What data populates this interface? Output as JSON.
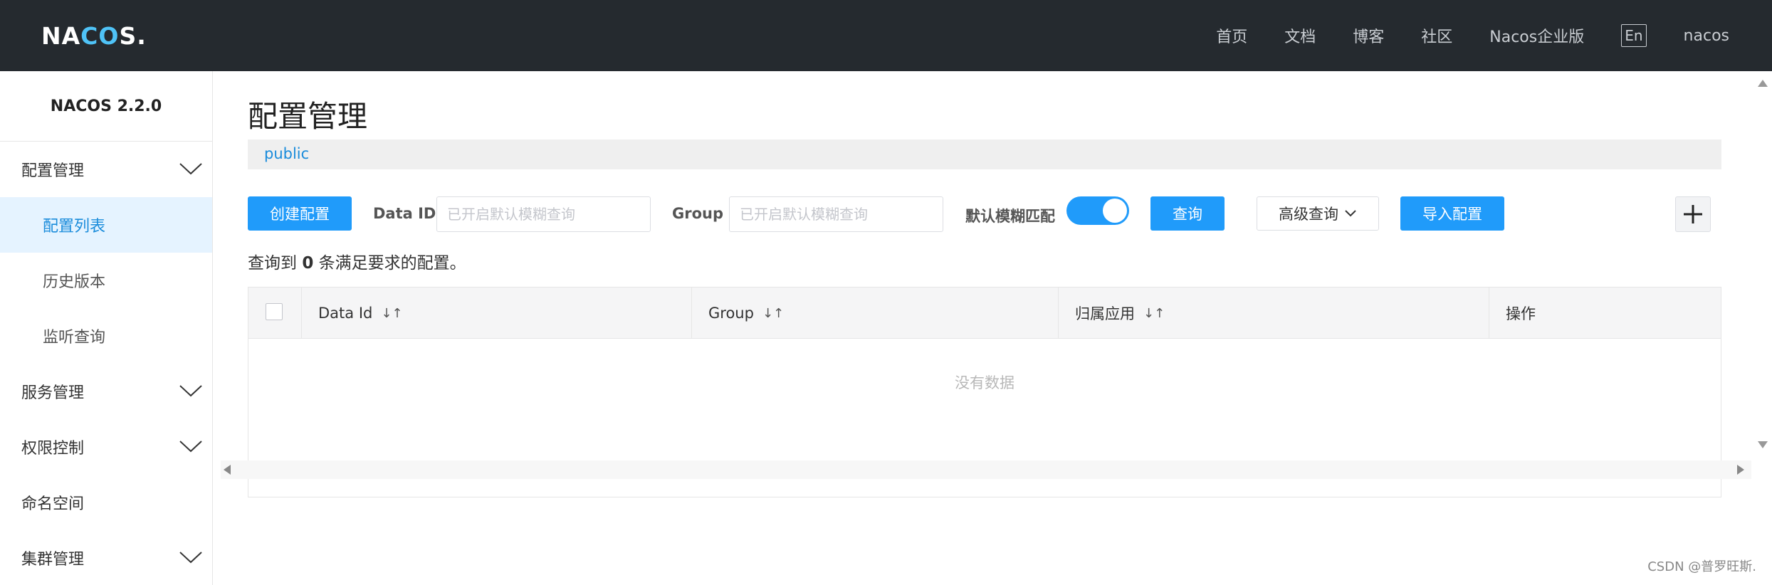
{
  "header": {
    "logo_prefix": "NA",
    "logo_oo": "CO",
    "logo_suffix": "S.",
    "nav": [
      "首页",
      "文档",
      "博客",
      "社区",
      "Nacos企业版"
    ],
    "lang": "En",
    "user": "nacos"
  },
  "sidebar": {
    "version": "NACOS 2.2.0",
    "items": [
      {
        "label": "配置管理",
        "expandable": true
      },
      {
        "label": "配置列表",
        "active": true
      },
      {
        "label": "历史版本"
      },
      {
        "label": "监听查询"
      },
      {
        "label": "服务管理",
        "expandable": true
      },
      {
        "label": "权限控制",
        "expandable": true
      },
      {
        "label": "命名空间"
      },
      {
        "label": "集群管理",
        "expandable": true
      }
    ]
  },
  "main": {
    "title": "配置管理",
    "namespace": "public",
    "toolbar": {
      "create_label": "创建配置",
      "data_id_label": "Data ID",
      "data_id_placeholder": "已开启默认模糊查询",
      "group_label": "Group",
      "group_placeholder": "已开启默认模糊查询",
      "fuzzy_label": "默认模糊匹配",
      "fuzzy_on": true,
      "query_label": "查询",
      "advanced_label": "高级查询",
      "import_label": "导入配置"
    },
    "result": {
      "prefix": "查询到",
      "count": "0",
      "suffix": "条满足要求的配置。"
    },
    "table": {
      "columns": [
        "Data Id",
        "Group",
        "归属应用",
        "操作"
      ],
      "empty_text": "没有数据"
    }
  },
  "watermark": "CSDN @普罗旺斯."
}
